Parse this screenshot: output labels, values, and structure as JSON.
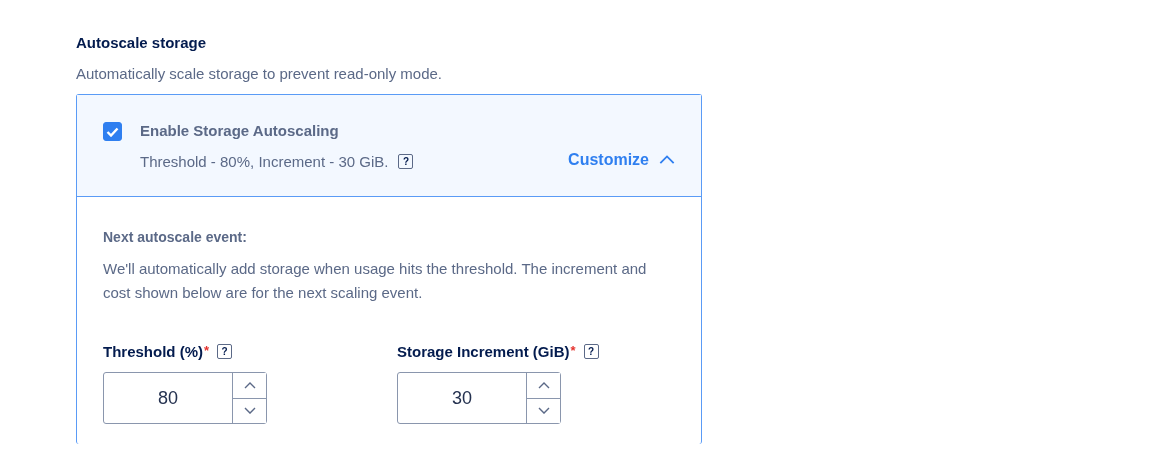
{
  "section": {
    "title": "Autoscale storage",
    "description": "Automatically scale storage to prevent read-only mode."
  },
  "autoscale": {
    "label": "Enable Storage Autoscaling",
    "checked": true,
    "summary": "Threshold - 80%, Increment - 30 GiB.",
    "help": "?",
    "customize": {
      "label": "Customize",
      "expanded": true
    }
  },
  "next_event": {
    "title": "Next autoscale event:",
    "description": "We'll automatically add storage when usage hits the threshold. The increment and cost shown below are for the next scaling event."
  },
  "fields": [
    {
      "label": "Threshold (%)",
      "required_mark": "*",
      "help": "?",
      "value": "80"
    },
    {
      "label": "Storage Increment (GiB)",
      "required_mark": "*",
      "help": "?",
      "value": "30"
    }
  ]
}
